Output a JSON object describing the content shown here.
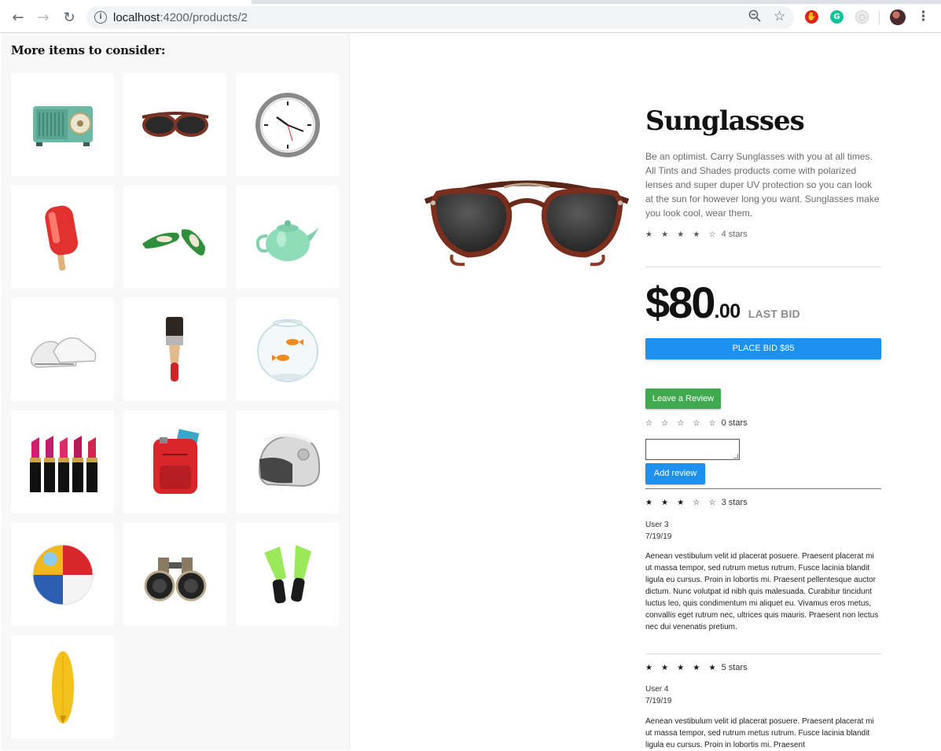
{
  "browser": {
    "url_host": "localhost",
    "url_path": ":4200/products/2"
  },
  "sidebar": {
    "heading": "More items to consider:",
    "items": [
      {
        "name": "radio-icon"
      },
      {
        "name": "sunglasses-icon"
      },
      {
        "name": "clock-icon"
      },
      {
        "name": "popsicle-icon"
      },
      {
        "name": "flats-icon"
      },
      {
        "name": "teapot-icon"
      },
      {
        "name": "sneakers-icon"
      },
      {
        "name": "paintbrush-icon"
      },
      {
        "name": "fishbowl-icon"
      },
      {
        "name": "lipstick-icon"
      },
      {
        "name": "backpack-icon"
      },
      {
        "name": "helmet-icon"
      },
      {
        "name": "beachball-icon"
      },
      {
        "name": "binoculars-icon"
      },
      {
        "name": "flippers-icon"
      },
      {
        "name": "surfboard-icon"
      }
    ]
  },
  "product": {
    "title": "Sunglasses",
    "description": "Be an optimist. Carry Sunglasses with you at all times. All Tints and Shades products come with polarized lenses and super duper UV protection so you can look at the sun for however long you want. Sunglasses make you look cool, wear them.",
    "rating_stars": "★ ★ ★ ★ ☆",
    "rating_label": "4 stars",
    "rating_value": 4,
    "price_dollars": "$80",
    "price_cents": ".00",
    "price_label": "LAST BID",
    "bid_button": "PLACE BID $85"
  },
  "review_form": {
    "leave_button": "Leave a Review",
    "stars": "☆ ☆ ☆ ☆ ☆",
    "stars_label": "0 stars",
    "add_button": "Add review"
  },
  "reviews": [
    {
      "stars": "★ ★ ★ ☆ ☆",
      "label": "3 stars",
      "user": "User 3",
      "date": "7/19/19",
      "text": "Aenean vestibulum velit id placerat posuere. Praesent placerat mi ut massa tempor, sed rutrum metus rutrum. Fusce lacinia blandit ligula eu cursus. Proin in lobortis mi. Praesent pellentesque auctor dictum. Nunc volutpat id nibh quis malesuada. Curabitur tincidunt luctus leo, quis condimentum mi aliquet eu. Vivamus eros metus, convallis eget rutrum nec, ultrices quis mauris. Praesent non lectus nec dui venenatis pretium."
    },
    {
      "stars": "★ ★ ★ ★ ★",
      "label": "5 stars",
      "user": "User 4",
      "date": "7/19/19",
      "text": "Aenean vestibulum velit id placerat posuere. Praesent placerat mi ut massa tempor, sed rutrum metus rutrum. Fusce lacinia blandit ligula eu cursus. Proin in lobortis mi. Praesent"
    }
  ],
  "colors": {
    "primary_button": "#1e90ee",
    "review_button": "#3fab4e"
  }
}
